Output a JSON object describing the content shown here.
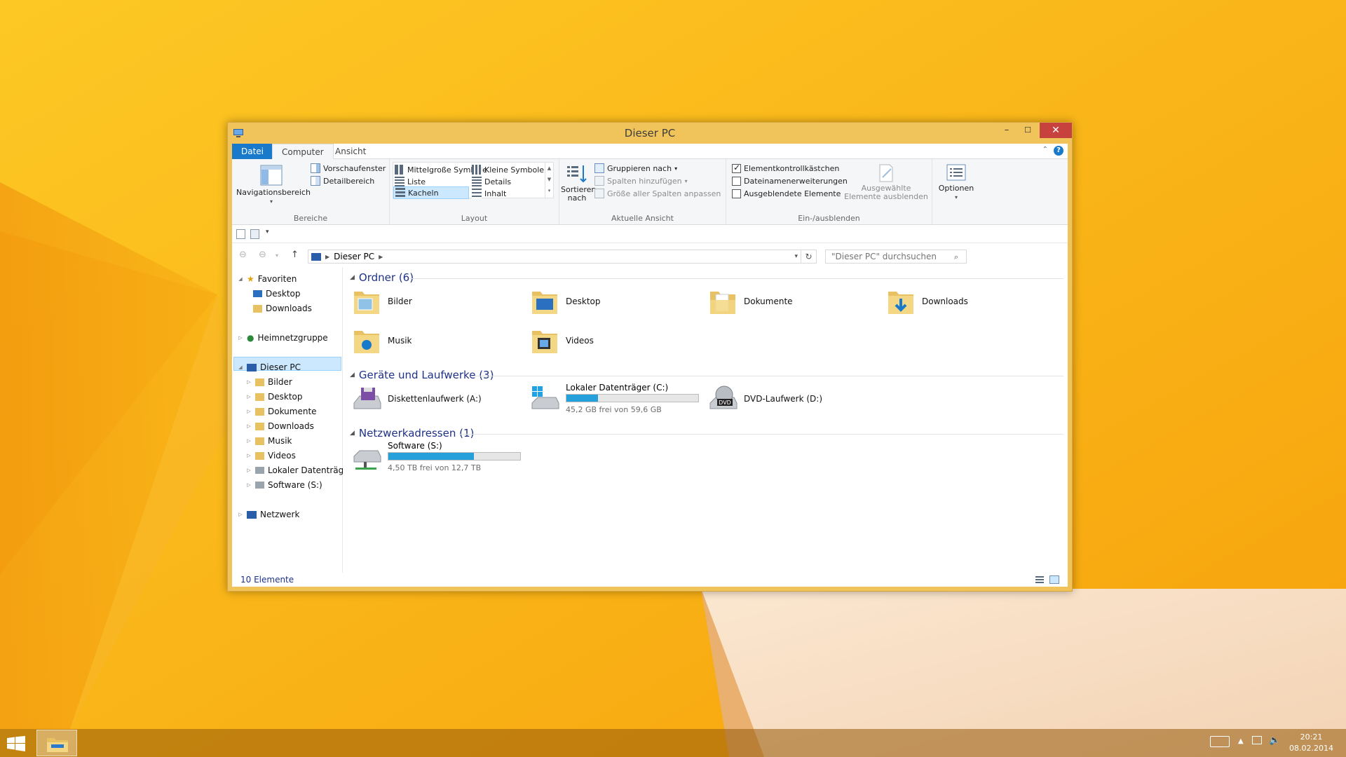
{
  "window": {
    "title": "Dieser PC",
    "minimize": "–",
    "maximize": "☐",
    "close": "✕"
  },
  "tabs": [
    "Datei",
    "Computer",
    "Ansicht"
  ],
  "ribbon": {
    "bereiche": {
      "nav": "Navigationsbereich",
      "preview": "Vorschaufenster",
      "details": "Detailbereich",
      "label": "Bereiche"
    },
    "layout": {
      "items": [
        "Mittelgroße Symbole",
        "Kleine Symbole",
        "Liste",
        "Details",
        "Kacheln",
        "Inhalt"
      ],
      "selected": "Kacheln",
      "label": "Layout"
    },
    "aktuelle": {
      "sort": "Sortieren nach",
      "group": "Gruppieren nach",
      "addcols": "Spalten hinzufügen",
      "fitcols": "Größe aller Spalten anpassen",
      "label": "Aktuelle Ansicht"
    },
    "einaus": {
      "chk1": "Elementkontrollkästchen",
      "chk2": "Dateinamenerweiterungen",
      "chk3": "Ausgeblendete Elemente",
      "hide": "Ausgewählte Elemente ausblenden",
      "label": "Ein-/ausblenden",
      "chk1_on": true,
      "chk2_on": false,
      "chk3_on": false
    },
    "options": "Optionen"
  },
  "address": {
    "path": "Dieser PC",
    "search_placeholder": "\"Dieser PC\" durchsuchen"
  },
  "nav": {
    "favorites": "Favoriten",
    "fav_items": [
      "Desktop",
      "Downloads"
    ],
    "homegroup": "Heimnetzgruppe",
    "pc": "Dieser PC",
    "pc_items": [
      "Bilder",
      "Desktop",
      "Dokumente",
      "Downloads",
      "Musik",
      "Videos",
      "Lokaler Datenträger",
      "Software (S:)"
    ],
    "network": "Netzwerk"
  },
  "content": {
    "folders_title": "Ordner (6)",
    "folders": [
      "Bilder",
      "Desktop",
      "Dokumente",
      "Downloads",
      "Musik",
      "Videos"
    ],
    "devices_title": "Geräte und Laufwerke (3)",
    "floppy": "Diskettenlaufwerk (A:)",
    "local": {
      "name": "Lokaler Datenträger (C:)",
      "free": "45,2 GB frei von 59,6 GB",
      "used_fraction": 0.24
    },
    "dvd": "DVD-Laufwerk (D:)",
    "network_title": "Netzwerkadressen (1)",
    "software": {
      "name": "Software (S:)",
      "free": "4,50 TB frei von 12,7 TB",
      "used_fraction": 0.65
    }
  },
  "status": "10 Elemente",
  "taskbar": {
    "time": "20:21",
    "date": "08.02.2014"
  }
}
